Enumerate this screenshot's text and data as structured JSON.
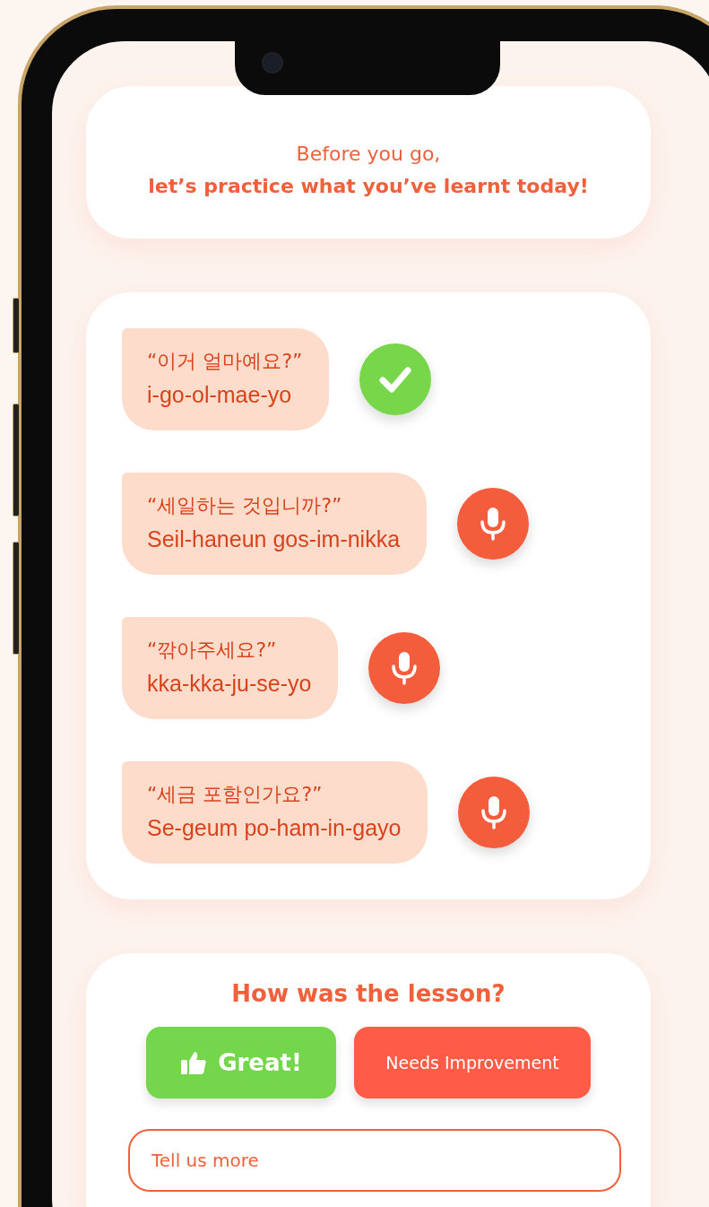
{
  "intro": {
    "line_1": "Before you go,",
    "line_2": "let’s practice what you’ve learnt today!"
  },
  "phrases": [
    {
      "korean": "“이거 얼마예요?”",
      "romanization": "i-go-ol-mae-yo",
      "kind": "done"
    },
    {
      "korean": "“세일하는 것입니까?”",
      "romanization": "Seil-haneun gos-im-nikka",
      "kind": "record"
    },
    {
      "korean": "“깎아주세요?”",
      "romanization": "kka-kka-ju-se-yo",
      "kind": "record"
    },
    {
      "korean": "“세금 포함인가요?”",
      "romanization": "Se-geum po-ham-in-gayo",
      "kind": "record"
    }
  ],
  "feedback": {
    "title": "How was the lesson?",
    "buttons": [
      {
        "label": "Great!",
        "kind": "positive"
      },
      {
        "label": "Needs Improvement",
        "kind": "negative"
      }
    ],
    "comment": {
      "placeholder": "Tell us more"
    }
  }
}
